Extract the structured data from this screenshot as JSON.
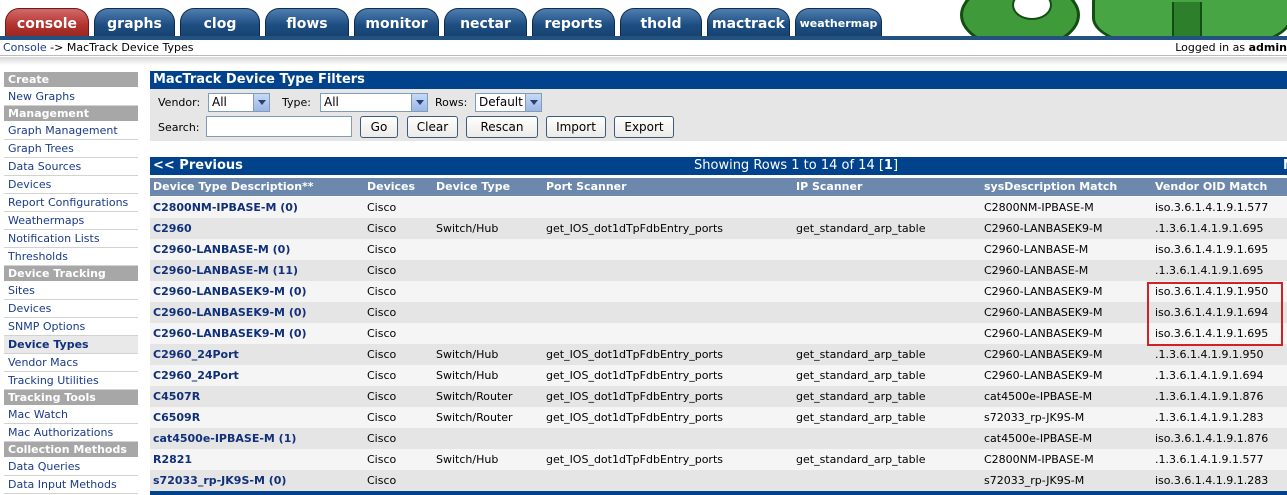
{
  "tabs": [
    {
      "label": "console",
      "active": true
    },
    {
      "label": "graphs"
    },
    {
      "label": "clog"
    },
    {
      "label": "flows"
    },
    {
      "label": "monitor"
    },
    {
      "label": "nectar"
    },
    {
      "label": "reports"
    },
    {
      "label": "thold"
    },
    {
      "label": "mactrack"
    },
    {
      "label": "weathermap"
    }
  ],
  "breadcrumb": {
    "root": "Console",
    "separator": " -> ",
    "current": "MacTrack Device Types"
  },
  "login": {
    "prefix": "Logged in as ",
    "user": "admin"
  },
  "sidebar": [
    {
      "type": "header",
      "label": "Create"
    },
    {
      "type": "item",
      "label": "New Graphs"
    },
    {
      "type": "header",
      "label": "Management"
    },
    {
      "type": "item",
      "label": "Graph Management"
    },
    {
      "type": "item",
      "label": "Graph Trees"
    },
    {
      "type": "item",
      "label": "Data Sources"
    },
    {
      "type": "item",
      "label": "Devices"
    },
    {
      "type": "item",
      "label": "Report Configurations"
    },
    {
      "type": "item",
      "label": "Weathermaps"
    },
    {
      "type": "item",
      "label": "Notification Lists"
    },
    {
      "type": "item",
      "label": "Thresholds"
    },
    {
      "type": "header",
      "label": "Device Tracking"
    },
    {
      "type": "item",
      "label": "Sites"
    },
    {
      "type": "item",
      "label": "Devices"
    },
    {
      "type": "item",
      "label": "SNMP Options"
    },
    {
      "type": "item",
      "label": "Device Types",
      "active": true
    },
    {
      "type": "item",
      "label": "Vendor Macs"
    },
    {
      "type": "item",
      "label": "Tracking Utilities"
    },
    {
      "type": "header",
      "label": "Tracking Tools"
    },
    {
      "type": "item",
      "label": "Mac Watch"
    },
    {
      "type": "item",
      "label": "Mac Authorizations"
    },
    {
      "type": "header",
      "label": "Collection Methods"
    },
    {
      "type": "item",
      "label": "Data Queries"
    },
    {
      "type": "item",
      "label": "Data Input Methods"
    }
  ],
  "filters": {
    "title": "MacTrack Device Type Filters",
    "vendor_label": "Vendor:",
    "vendor_value": "All",
    "type_label": "Type:",
    "type_value": "All",
    "rows_label": "Rows:",
    "rows_value": "Default",
    "search_label": "Search:",
    "search_value": "",
    "buttons": {
      "go": "Go",
      "clear": "Clear",
      "rescan": "Rescan",
      "import": "Import",
      "export": "Export"
    }
  },
  "pager": {
    "previous": "<< Previous",
    "showing": "Showing Rows 1 to 14 of 14 [",
    "page": "1",
    "close": "]",
    "next": "N"
  },
  "table": {
    "columns": [
      "Device Type Description**",
      "Devices",
      "Device Type",
      "Port Scanner",
      "IP Scanner",
      "sysDescription Match",
      "Vendor OID Match"
    ],
    "rows": [
      [
        "C2800NM-IPBASE-M (0)",
        "Cisco",
        "",
        "",
        "",
        "C2800NM-IPBASE-M",
        "iso.3.6.1.4.1.9.1.577"
      ],
      [
        "C2960",
        "Cisco",
        "Switch/Hub",
        "get_IOS_dot1dTpFdbEntry_ports",
        "get_standard_arp_table",
        "C2960-LANBASEK9-M",
        ".1.3.6.1.4.1.9.1.695"
      ],
      [
        "C2960-LANBASE-M (0)",
        "Cisco",
        "",
        "",
        "",
        "C2960-LANBASE-M",
        "iso.3.6.1.4.1.9.1.695"
      ],
      [
        "C2960-LANBASE-M (11)",
        "Cisco",
        "",
        "",
        "",
        "C2960-LANBASE-M",
        ".1.3.6.1.4.1.9.1.695"
      ],
      [
        "C2960-LANBASEK9-M (0)",
        "Cisco",
        "",
        "",
        "",
        "C2960-LANBASEK9-M",
        "iso.3.6.1.4.1.9.1.950"
      ],
      [
        "C2960-LANBASEK9-M (0)",
        "Cisco",
        "",
        "",
        "",
        "C2960-LANBASEK9-M",
        "iso.3.6.1.4.1.9.1.694"
      ],
      [
        "C2960-LANBASEK9-M (0)",
        "Cisco",
        "",
        "",
        "",
        "C2960-LANBASEK9-M",
        "iso.3.6.1.4.1.9.1.695"
      ],
      [
        "C2960_24Port",
        "Cisco",
        "Switch/Hub",
        "get_IOS_dot1dTpFdbEntry_ports",
        "get_standard_arp_table",
        "C2960-LANBASEK9-M",
        ".1.3.6.1.4.1.9.1.950"
      ],
      [
        "C2960_24Port",
        "Cisco",
        "Switch/Hub",
        "get_IOS_dot1dTpFdbEntry_ports",
        "get_standard_arp_table",
        "C2960-LANBASEK9-M",
        ".1.3.6.1.4.1.9.1.694"
      ],
      [
        "C4507R",
        "Cisco",
        "Switch/Router",
        "get_IOS_dot1dTpFdbEntry_ports",
        "get_standard_arp_table",
        "cat4500e-IPBASE-M",
        ".1.3.6.1.4.1.9.1.876"
      ],
      [
        "C6509R",
        "Cisco",
        "Switch/Router",
        "get_IOS_dot1dTpFdbEntry_ports",
        "get_standard_arp_table",
        "s72033_rp-JK9S-M",
        ".1.3.6.1.4.1.9.1.283"
      ],
      [
        "cat4500e-IPBASE-M (1)",
        "Cisco",
        "",
        "",
        "",
        "cat4500e-IPBASE-M",
        "iso.3.6.1.4.1.9.1.876"
      ],
      [
        "R2821",
        "Cisco",
        "Switch/Hub",
        "get_IOS_dot1dTpFdbEntry_ports",
        "get_standard_arp_table",
        "C2800NM-IPBASE-M",
        ".1.3.6.1.4.1.9.1.577"
      ],
      [
        "s72033_rp-JK9S-M (0)",
        "Cisco",
        "",
        "",
        "",
        "s72033_rp-JK9S-M",
        "iso.3.6.1.4.1.9.1.283"
      ]
    ]
  }
}
